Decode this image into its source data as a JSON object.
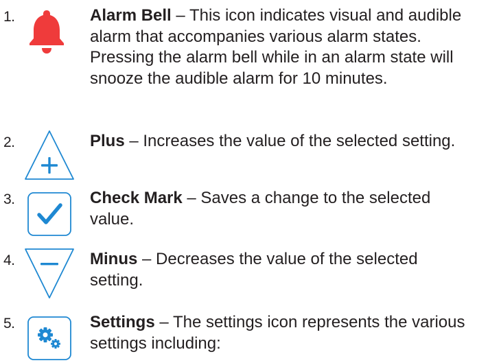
{
  "colors": {
    "text": "#231f20",
    "icon_blue": "#1e88d2",
    "bell_red": "#ef3b3b"
  },
  "items": [
    {
      "number": "1.",
      "icon": "bell-icon",
      "term": "Alarm Bell",
      "description": " – This icon indicates visual and audible alarm that accompanies various alarm states. Pressing the alarm bell while in an alarm state will snooze the audible alarm for 10 minutes."
    },
    {
      "number": "2.",
      "icon": "plus-icon",
      "term": "Plus",
      "description": " – Increases the value of the selected setting."
    },
    {
      "number": "3.",
      "icon": "check-mark-icon",
      "term": "Check Mark",
      "description": " – Saves a change to the selected value."
    },
    {
      "number": "4.",
      "icon": "minus-icon",
      "term": "Minus",
      "description": " – Decreases the value of the selected setting."
    },
    {
      "number": "5.",
      "icon": "settings-icon",
      "term": "Settings",
      "description": " – The settings icon represents the various settings including:"
    }
  ]
}
